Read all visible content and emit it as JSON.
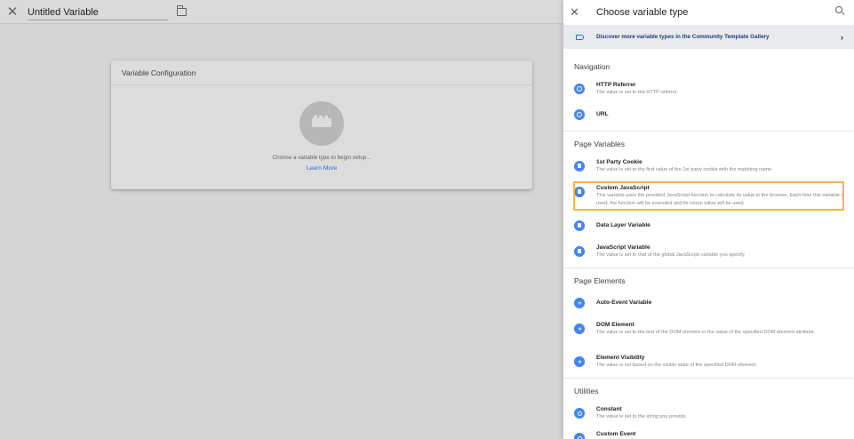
{
  "editor": {
    "variable_name": "Untitled Variable",
    "config_title": "Variable Configuration",
    "choose_text": "Choose a variable type to begin setup...",
    "learn_more": "Learn More"
  },
  "panel": {
    "title": "Choose variable type",
    "banner": "Discover more variable types in the Community Template Gallery",
    "sections": {
      "navigation": "Navigation",
      "page_variables": "Page Variables",
      "page_elements": "Page Elements",
      "utilities": "Utilities"
    },
    "items": {
      "http_referrer": {
        "title": "HTTP Referrer",
        "desc": "The value is set to the HTTP referrer.",
        "icon": "globe-icon"
      },
      "url": {
        "title": "URL",
        "desc": "",
        "icon": "globe-icon"
      },
      "first_party_cookie": {
        "title": "1st Party Cookie",
        "desc": "The value is set to the first value of the 1st party cookie with the matching name.",
        "icon": "document-icon"
      },
      "custom_javascript": {
        "title": "Custom JavaScript",
        "desc": "This variable uses the provided JavaScript function to calculate its value in the browser. Each time this variable is used, the function will be executed and its return value will be used.",
        "icon": "document-icon"
      },
      "data_layer_variable": {
        "title": "Data Layer Variable",
        "desc": "",
        "icon": "document-icon"
      },
      "javascript_variable": {
        "title": "JavaScript Variable",
        "desc": "The value is set to that of the global JavaScript variable you specify.",
        "icon": "document-icon"
      },
      "auto_event_variable": {
        "title": "Auto-Event Variable",
        "desc": "",
        "icon": "code-icon"
      },
      "dom_element": {
        "title": "DOM Element",
        "desc": "The value is set to the text of the DOM element or the value of the specified DOM element attribute.",
        "icon": "code-icon"
      },
      "element_visibility": {
        "title": "Element Visibility",
        "desc": "The value is set based on the visible state of the specified DOM element.",
        "icon": "code-icon"
      },
      "constant": {
        "title": "Constant",
        "desc": "The value is set to the string you provide.",
        "icon": "gear-icon"
      },
      "custom_event": {
        "title": "Custom Event",
        "desc": "",
        "icon": "gear-icon"
      }
    }
  },
  "colors": {
    "accent": "#4285f4",
    "link": "#1a73e8",
    "highlight": "#f6b73c"
  }
}
